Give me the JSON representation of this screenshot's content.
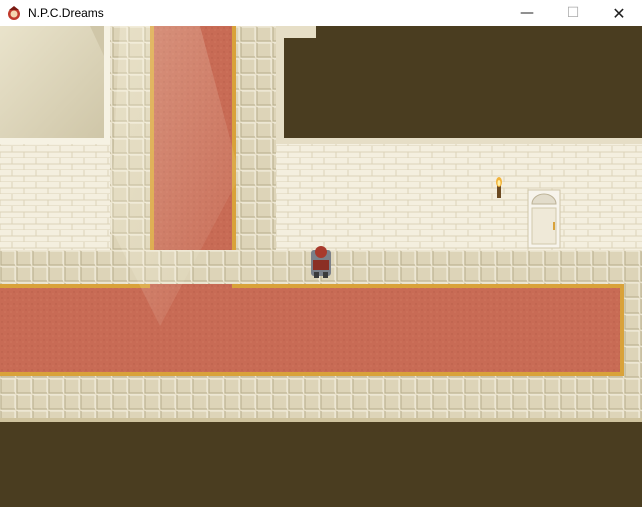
{
  "window": {
    "title": "N.P.C.Dreams",
    "icons": [
      "app-icon",
      "minimize-icon",
      "maximize-icon",
      "close-icon"
    ],
    "min_label": "—",
    "max_label": "☐",
    "close_label": "✕"
  },
  "scene": {
    "description_tags": [
      "hallway",
      "red-carpet",
      "stone-tiles",
      "brick-wall",
      "door",
      "wall-torch",
      "player-character",
      "light-rays"
    ],
    "colors": {
      "void": "#4a3d20",
      "carpet": "#c96a55",
      "carpet_border": "#d9a23a",
      "tile": "#e8e0c8",
      "tile_line": "#bfb592",
      "wall": "#f2ecda",
      "brick_line": "#d9cfb2",
      "door": "#f4f0e6"
    }
  }
}
